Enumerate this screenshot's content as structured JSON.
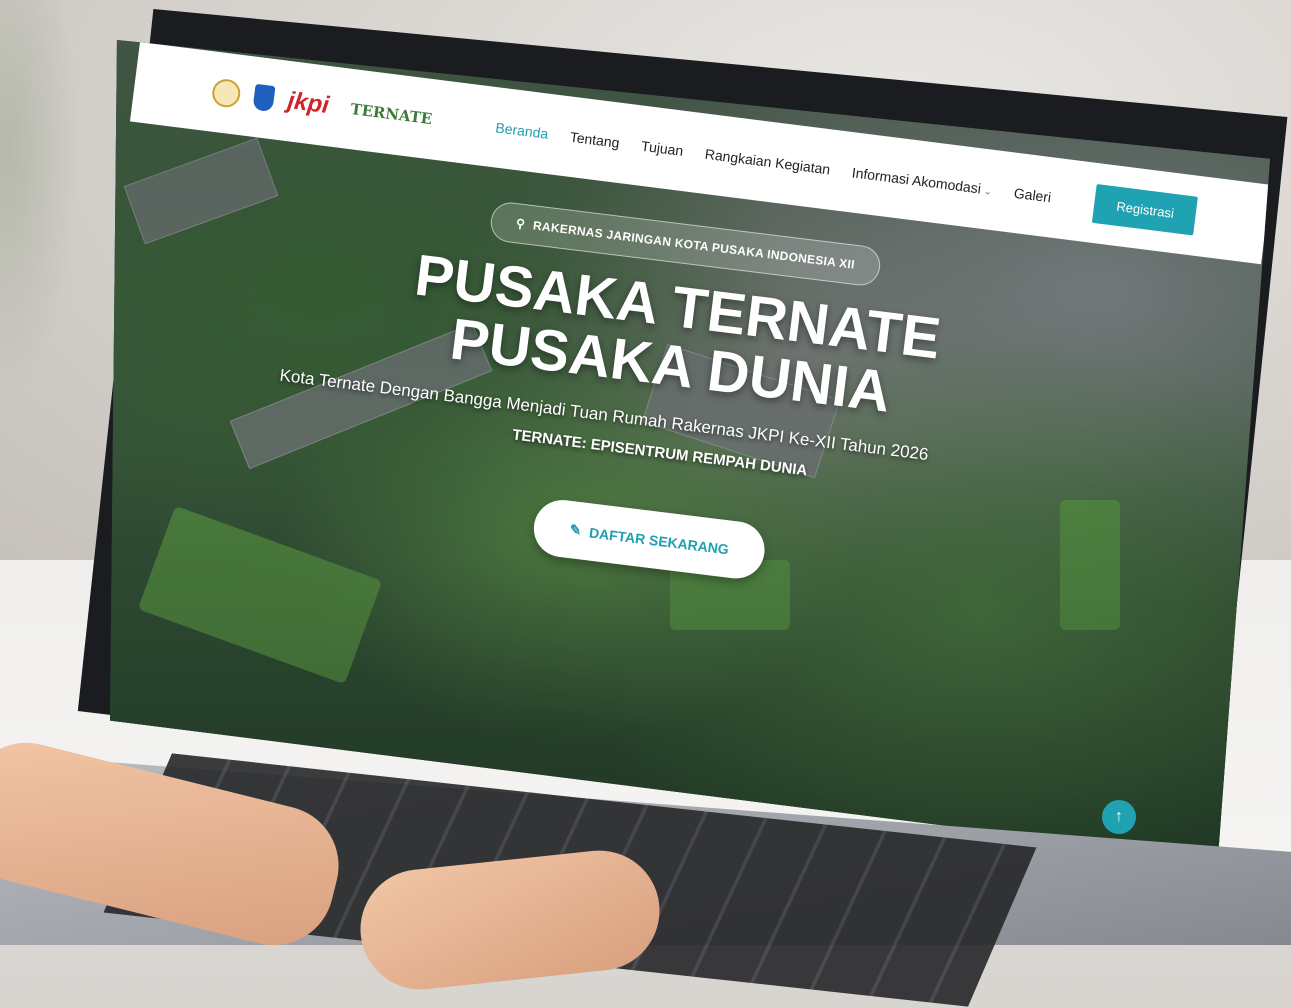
{
  "navbar": {
    "logos": [
      "seal-logo",
      "province-shield-logo",
      "jkpi-logo",
      "ternate-logo"
    ],
    "jkpi_text": "jkpi",
    "ternate_text": "TERNATE",
    "items": [
      {
        "label": "Beranda",
        "active": true
      },
      {
        "label": "Tentang"
      },
      {
        "label": "Tujuan"
      },
      {
        "label": "Rangkaian Kegiatan"
      },
      {
        "label": "Informasi Akomodasi",
        "has_dropdown": true
      },
      {
        "label": "Galeri"
      }
    ],
    "register_label": "Registrasi"
  },
  "hero": {
    "badge": "RAKERNAS JARINGAN KOTA PUSAKA INDONESIA XII",
    "title_line1": "PUSAKA TERNATE",
    "title_line2": "PUSAKA DUNIA",
    "subtitle": "Kota Ternate Dengan Bangga Menjadi Tuan Rumah Rakernas JKPI Ke-XII Tahun 2026",
    "tagline": "TERNATE: EPISENTRUM REMPAH DUNIA",
    "cta_label": "DAFTAR SEKARANG"
  },
  "colors": {
    "accent": "#1fa3b3",
    "nav_active": "#1fa0b0",
    "jkpi_red": "#d2232a"
  },
  "icons": {
    "badge": "map-pin-icon",
    "cta": "edit-icon",
    "scroll_top": "arrow-up-icon"
  }
}
